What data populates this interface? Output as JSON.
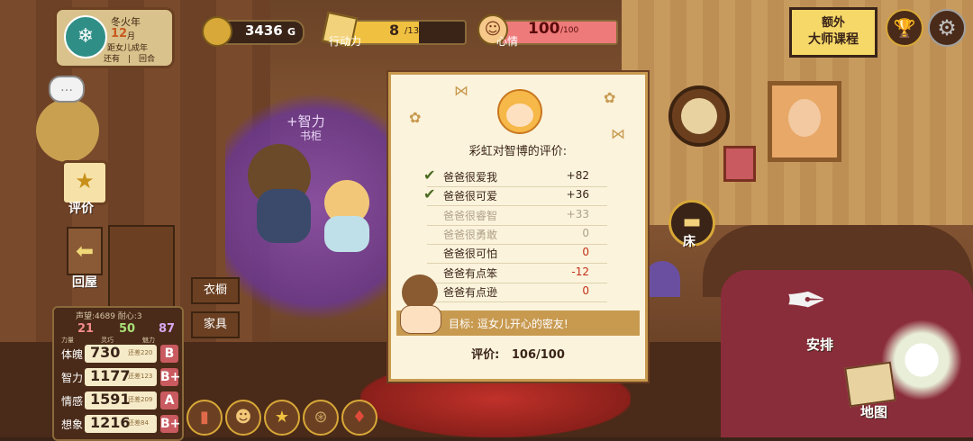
{
  "season": {
    "season_name": "冬火年",
    "month_num": "12",
    "month_unit": "月",
    "line3": "距女儿成年",
    "line4": "还有　|　回合",
    "emblem_icon": "snowflake-icon"
  },
  "resources": {
    "gold": "3436",
    "gold_unit": "G",
    "action_label": "行动力",
    "action_value": "8",
    "action_max": "/13",
    "action_fraction": 0.615,
    "mood_label": "心情",
    "mood_value": "100",
    "mood_max": "/100",
    "mood_fraction": 1.0
  },
  "top_right": {
    "extra_line1": "额外",
    "extra_line2": "大师课程",
    "trophy_icon": "trophy-icon",
    "settings_icon": "gear-icon"
  },
  "left_nav": {
    "evaluation_label": "评价",
    "back_label": "回屋"
  },
  "scene": {
    "floating_stat": "+智力",
    "floating_sub": "书柜",
    "wardrobe_label": "衣橱",
    "furniture_label": "家具",
    "bed_label": "床",
    "arrange_label": "安排",
    "map_label": "地图"
  },
  "stats": {
    "reputation": "声望:4689 耐心:3",
    "attributes": [
      {
        "value": "21",
        "label": "力量",
        "color": "#f08a8a"
      },
      {
        "value": "50",
        "label": "灵巧",
        "color": "#a8e078"
      },
      {
        "value": "87",
        "label": "魅力",
        "color": "#d8a8f0"
      }
    ],
    "rows": [
      {
        "name": "体魄",
        "value": "730",
        "remain": "还差220",
        "grade": "B"
      },
      {
        "name": "智力",
        "value": "1177",
        "remain": "还差123",
        "grade": "B+"
      },
      {
        "name": "情感",
        "value": "1591",
        "remain": "还差209",
        "grade": "A"
      },
      {
        "name": "想象",
        "value": "1216",
        "remain": "还差84",
        "grade": "B+"
      }
    ]
  },
  "bottom_icons": [
    "chart-icon",
    "portrait-icon",
    "star-icon",
    "bag-icon",
    "card-icon"
  ],
  "evaluation": {
    "title": "彩虹对智博的评价:",
    "items": [
      {
        "label": "爸爸很爱我",
        "value": "+82",
        "checked": true,
        "active": true
      },
      {
        "label": "爸爸很可爱",
        "value": "+36",
        "checked": true,
        "active": true
      },
      {
        "label": "爸爸很睿智",
        "value": "+33",
        "checked": false,
        "active": false
      },
      {
        "label": "爸爸很勇敢",
        "value": "0",
        "checked": false,
        "active": false
      },
      {
        "label": "爸爸很可怕",
        "value": "0",
        "checked": false,
        "active": true
      },
      {
        "label": "爸爸有点笨",
        "value": "-12",
        "checked": false,
        "active": true
      },
      {
        "label": "爸爸有点逊",
        "value": "0",
        "checked": false,
        "active": true
      }
    ],
    "goal": "目标: 逗女儿开心的密友!",
    "score_label": "评价:",
    "score_value": "106/100"
  },
  "colors": {
    "active_text": "#3a2418",
    "inactive_text": "#b0a28a",
    "negative": "#c0301a",
    "check": "#4a6a20"
  }
}
